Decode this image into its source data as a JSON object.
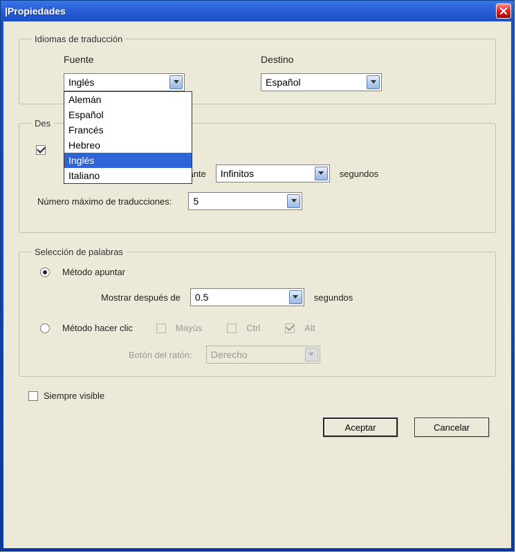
{
  "window": {
    "title": "|Propiedades"
  },
  "groups": {
    "languages": {
      "legend": "Idiomas de traducción",
      "source_label": "Fuente",
      "dest_label": "Destino",
      "source_value": "Inglés",
      "dest_value": "Español",
      "source_options": [
        "Alemán",
        "Español",
        "Francés",
        "Hebreo",
        "Inglés",
        "Italiano"
      ],
      "source_highlighted": "Inglés"
    },
    "display": {
      "legend_prefix": "Des",
      "checkbox_checked": true,
      "show_for_label": "Mostrar durante",
      "show_for_value": "Infinitos",
      "seconds_label": "segundos",
      "max_label": "Número máximo de traducciones:",
      "max_value": "5"
    },
    "words": {
      "legend": "Selección de palabras",
      "point_label": "Método apuntar",
      "point_selected": true,
      "show_after_label": "Mostrar después de",
      "show_after_value": "0.5",
      "seconds_label": "segundos",
      "click_label": "Método hacer clic",
      "click_selected": false,
      "shift_label": "Mayús",
      "ctrl_label": "Ctrl",
      "alt_label": "Alt",
      "alt_checked": true,
      "mouse_button_label": "Botón del ratón:",
      "mouse_button_value": "Derecho"
    }
  },
  "always_visible": {
    "label": "Siempre visible",
    "checked": false
  },
  "buttons": {
    "ok": "Aceptar",
    "cancel": "Cancelar"
  }
}
